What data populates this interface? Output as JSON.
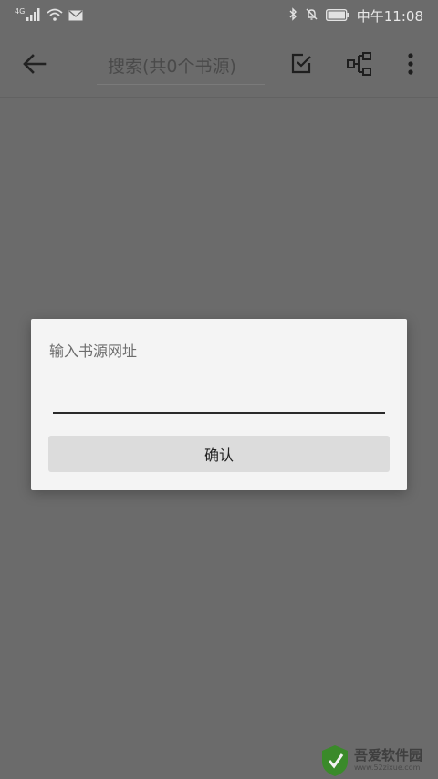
{
  "status_bar": {
    "network_label": "4G",
    "time": "中午11:08",
    "icons": [
      "signal-icon",
      "wifi-icon",
      "mail-icon",
      "bluetooth-icon",
      "mute-bell-icon",
      "battery-icon"
    ]
  },
  "toolbar": {
    "back_icon": "arrow-left-icon",
    "search_placeholder": "搜索(共0个书源)",
    "action_icons": [
      "checkbox-edit-icon",
      "hierarchy-icon",
      "more-vert-icon"
    ]
  },
  "dialog": {
    "title": "输入书源网址",
    "input_value": "",
    "confirm_label": "确认"
  },
  "watermark": {
    "title": "吾爱软件园",
    "url": "www.52zixue.com"
  },
  "colors": {
    "background": "#6b6b6b",
    "dialog_bg": "#f4f4f4",
    "button_bg": "#dcdcdc"
  }
}
